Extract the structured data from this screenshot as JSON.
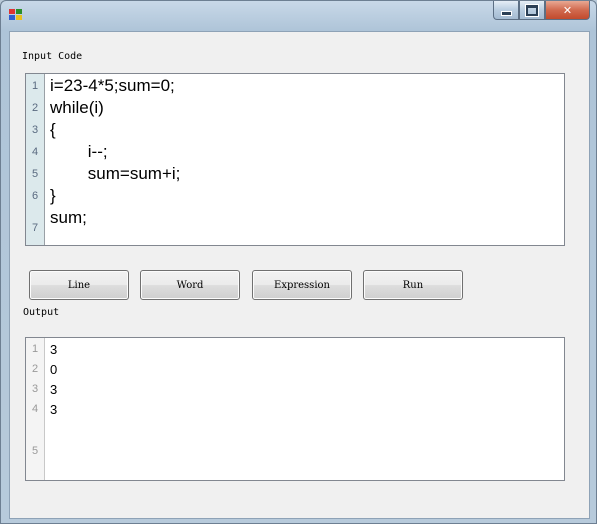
{
  "window": {
    "title": ""
  },
  "input_section": {
    "label": "Input Code",
    "line_numbers": [
      "1",
      "2",
      "3",
      "4",
      "5",
      "6",
      "7"
    ],
    "lines": [
      "i=23-4*5;sum=0;",
      "while(i)",
      "{",
      "        i--;",
      "        sum=sum+i;",
      "}",
      "sum;"
    ]
  },
  "buttons": {
    "line": "Line",
    "word": "Word",
    "expression": "Expression",
    "run": "Run"
  },
  "output_section": {
    "label": "Output",
    "line_numbers": [
      "1",
      "2",
      "3",
      "4",
      "5"
    ],
    "lines": [
      "3",
      "0",
      "3",
      "3",
      ""
    ]
  },
  "colors": {
    "code_gutter": "#dce9ec",
    "client_background": "#f0f0f0",
    "close_button": "#c24a2d"
  },
  "icons": [
    "app-icon",
    "minimize-icon",
    "maximize-icon",
    "close-icon"
  ]
}
